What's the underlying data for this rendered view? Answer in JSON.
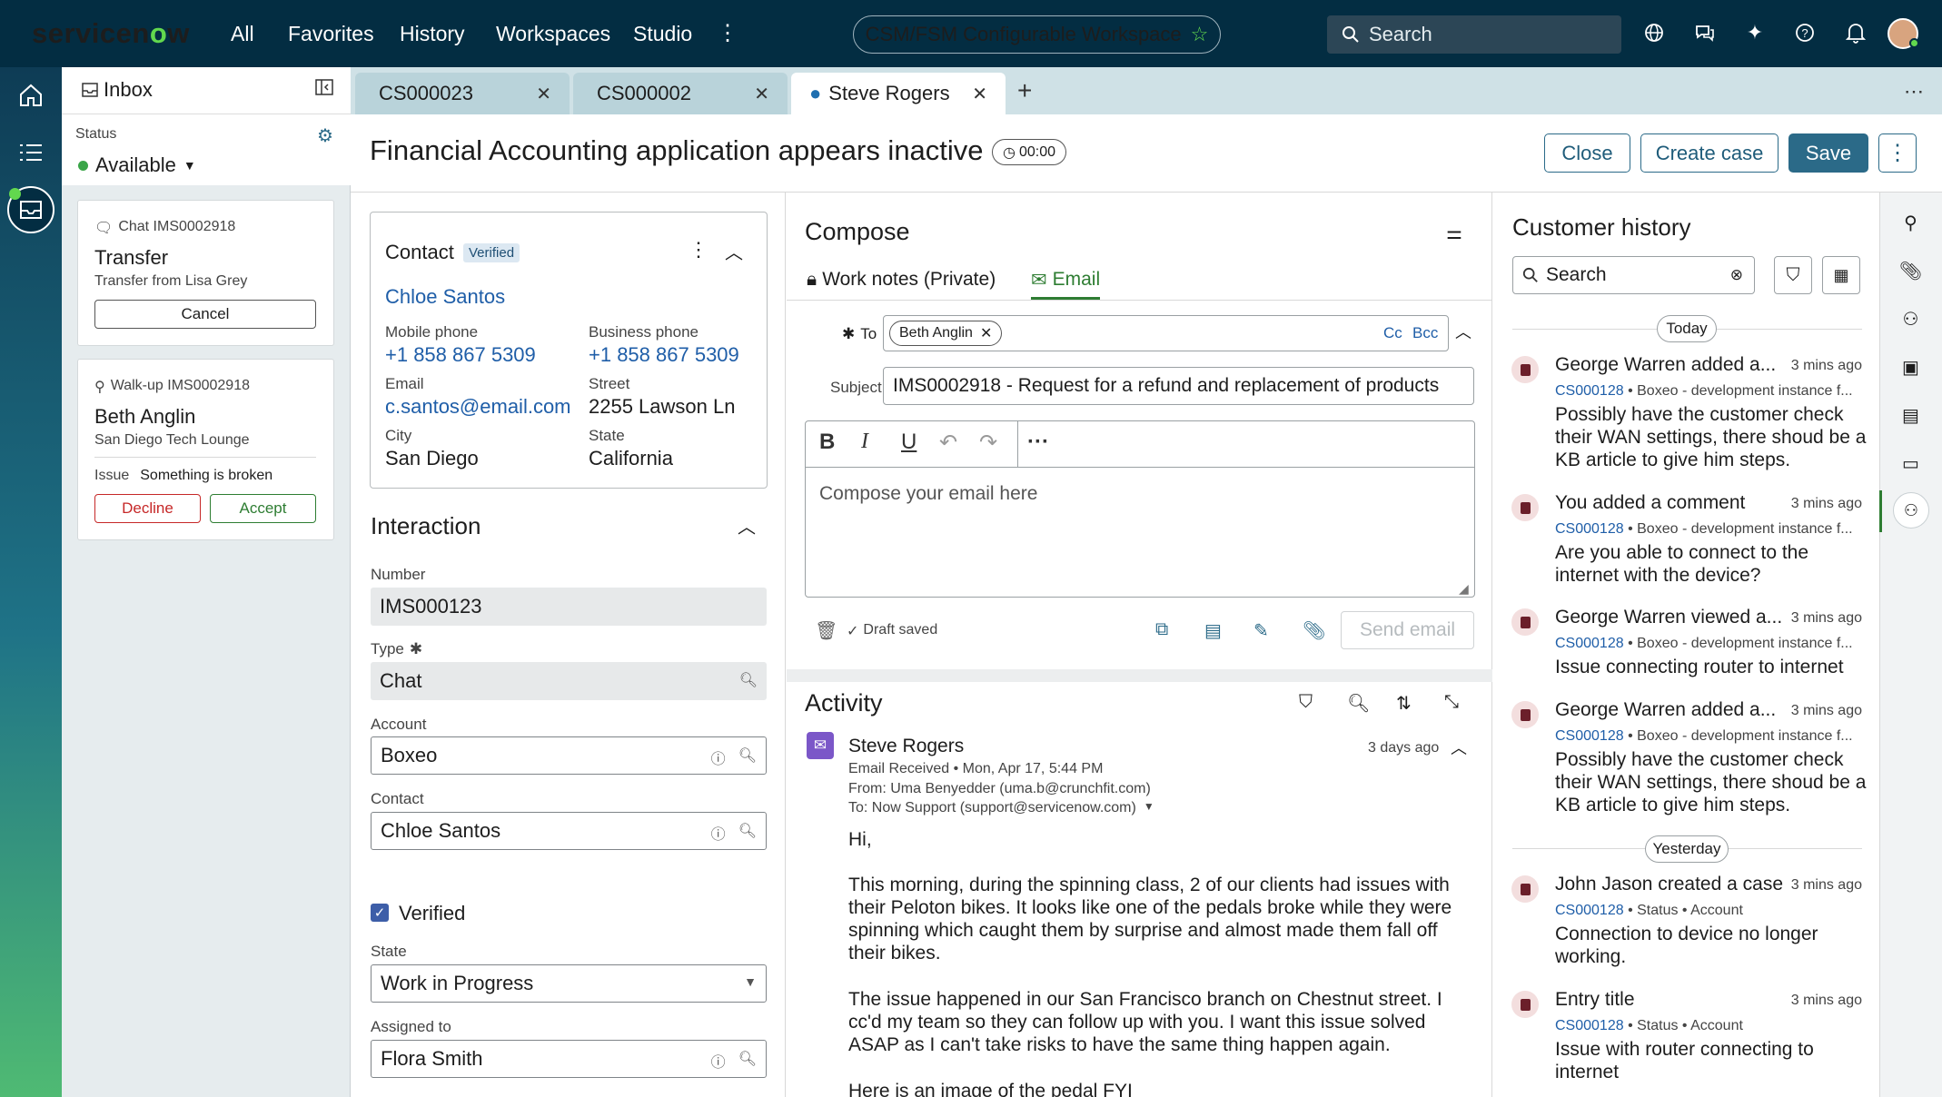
{
  "topbar": {
    "logo_pre": "servicen",
    "logo_o": "o",
    "logo_post": "w",
    "nav": [
      "All",
      "Favorites",
      "History",
      "Workspaces",
      "Studio"
    ],
    "workspace_label": "CSM/FSM Configurable Workspace",
    "search_label": "Search"
  },
  "inbox": {
    "title": "Inbox",
    "status_label": "Status",
    "status_value": "Available",
    "cards": [
      {
        "channel": "Chat IMS0002918",
        "name": "Transfer",
        "sub": "Transfer from Lisa Grey",
        "button": "Cancel"
      },
      {
        "channel": "Walk-up IMS0002918",
        "name": "Beth Anglin",
        "sub": "San Diego Tech Lounge",
        "issue_label": "Issue",
        "issue_value": "Something is broken",
        "decline": "Decline",
        "accept": "Accept"
      }
    ]
  },
  "tabs": [
    {
      "label": "CS000023"
    },
    {
      "label": "CS000002"
    },
    {
      "label": "Steve Rogers"
    }
  ],
  "header": {
    "title": "Financial Accounting application appears inactive",
    "timer": "00:00",
    "close": "Close",
    "create_case": "Create case",
    "save": "Save"
  },
  "contact": {
    "heading": "Contact",
    "badge": "Verified",
    "name": "Chloe Santos",
    "mobile_label": "Mobile phone",
    "mobile": "+1 858 867 5309",
    "business_label": "Business phone",
    "business": "+1 858 867 5309",
    "email_label": "Email",
    "email": "c.santos@email.com",
    "street_label": "Street",
    "street": "2255 Lawson Ln",
    "city_label": "City",
    "city": "San Diego",
    "state_label": "State",
    "state": "California"
  },
  "interaction": {
    "heading": "Interaction",
    "number_label": "Number",
    "number": "IMS000123",
    "type_label": "Type",
    "type": "Chat",
    "account_label": "Account",
    "account": "Boxeo",
    "contact_label": "Contact",
    "contact": "Chloe Santos",
    "verified_label": "Verified",
    "state_label": "State",
    "state": "Work in Progress",
    "assigned_label": "Assigned to",
    "assigned": "Flora Smith"
  },
  "compose": {
    "heading": "Compose",
    "tab_notes": "Work notes (Private)",
    "tab_email": "Email",
    "to_label": "To",
    "to_chip": "Beth Anglin",
    "cc": "Cc",
    "bcc": "Bcc",
    "subject_label": "Subject",
    "subject": "IMS0002918 - Request for a refund and replacement of products",
    "placeholder": "Compose your email here",
    "draft": "Draft saved",
    "send": "Send email"
  },
  "activity": {
    "heading": "Activity",
    "author": "Steve Rogers",
    "ago": "3 days ago",
    "kind": "Email Received",
    "date": "Mon, Apr 17, 5:44 PM",
    "from": "From:  Uma Benyedder (uma.b@crunchfit.com)",
    "to": "To:  Now Support (support@servicenow.com)",
    "greeting": "Hi,",
    "p1": "This morning, during the spinning class, 2 of our clients had issues with their Peloton bikes. It looks like one of the pedals broke while they were spinning which caught them by surprise and almost made them fall off their bikes.",
    "p2": "The issue happened in our San Francisco branch on Chestnut street. I cc'd my team so they can follow up with you. I want this issue solved ASAP as I can't take risks to have the same thing happen again.",
    "p3": "Here is an image of the pedal FYI"
  },
  "history": {
    "heading": "Customer history",
    "search_placeholder": "Search",
    "today": "Today",
    "yesterday": "Yesterday",
    "entries": [
      {
        "title": "George Warren added a...",
        "time": "3 mins ago",
        "case": "CS000128",
        "meta": "Boxeo - development instance f...",
        "body": "Possibly have the customer check their WAN settings, there shoud be a KB article to give him steps."
      },
      {
        "title": "You added a comment",
        "time": "3 mins ago",
        "case": "CS000128",
        "meta": "Boxeo - development instance f...",
        "body": "Are you able to connect to the internet with the device?"
      },
      {
        "title": "George Warren viewed a...",
        "time": "3 mins ago",
        "case": "CS000128",
        "meta": "Boxeo - development instance f...",
        "body": "Issue connecting router to internet"
      },
      {
        "title": "George Warren added a...",
        "time": "3 mins ago",
        "case": "CS000128",
        "meta": "Boxeo - development instance f...",
        "body": "Possibly have the customer check their WAN settings, there shoud be a KB article to give him steps."
      },
      {
        "title": "John Jason created a case",
        "time": "3 mins ago",
        "case": "CS000128",
        "meta": "Status  •  Account",
        "body": "Connection to device no longer working."
      },
      {
        "title": "Entry title",
        "time": "3 mins ago",
        "case": "CS000128",
        "meta": "Status  •  Account",
        "body": "Issue with router connecting to internet"
      }
    ]
  },
  "colors": {
    "brand_green": "#62d84e",
    "header_bg": "#032d42",
    "primary": "#2b6a88",
    "link": "#1f5ea8"
  }
}
